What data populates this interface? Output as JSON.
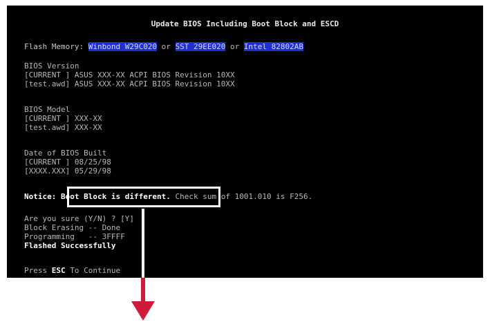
{
  "bios": {
    "title": "Update BIOS Including Boot Block and ESCD",
    "flash_label": "Flash Memory: ",
    "flash_chip_1": "Winbond W29C020",
    "flash_or_1": " or ",
    "flash_chip_2": "SST 29EE020",
    "flash_or_2": " or ",
    "flash_chip_3": "Intel 82802AB",
    "version_header": "BIOS Version",
    "version_current": "[CURRENT ] ASUS XXX-XX ACPI BIOS Revision 10XX",
    "version_file": "[test.awd] ASUS XXX-XX ACPI BIOS Revision 10XX",
    "model_header": "BIOS Model",
    "model_current": "[CURRENT ] XXX-XX",
    "model_file": "[test.awd] XXX-XX",
    "date_header": "Date of BIOS Built",
    "date_current": "[CURRENT ] 08/25/98",
    "date_file": "[XXXX.XXX] 05/29/98",
    "notice_label": "Notice: ",
    "notice_text": "Boot Block is different.",
    "notice_check": " Check sum of 1001.010 is F256.",
    "prompt": "Are you sure (Y/N) ? [Y]",
    "erasing": "Block Erasing -- Done",
    "programming": "Programming   -- 3FFFF",
    "flashed": "Flashed Successfully",
    "press_prefix": "Press ",
    "press_key": "ESC",
    "press_suffix": " To Continue"
  },
  "colors": {
    "screen_bg": "#000000",
    "highlight_bg": "#1f2fd0",
    "callout_box": "#ffffff",
    "arrow": "#cf1b3a"
  },
  "icons": {
    "callout": "down-arrow-icon"
  }
}
